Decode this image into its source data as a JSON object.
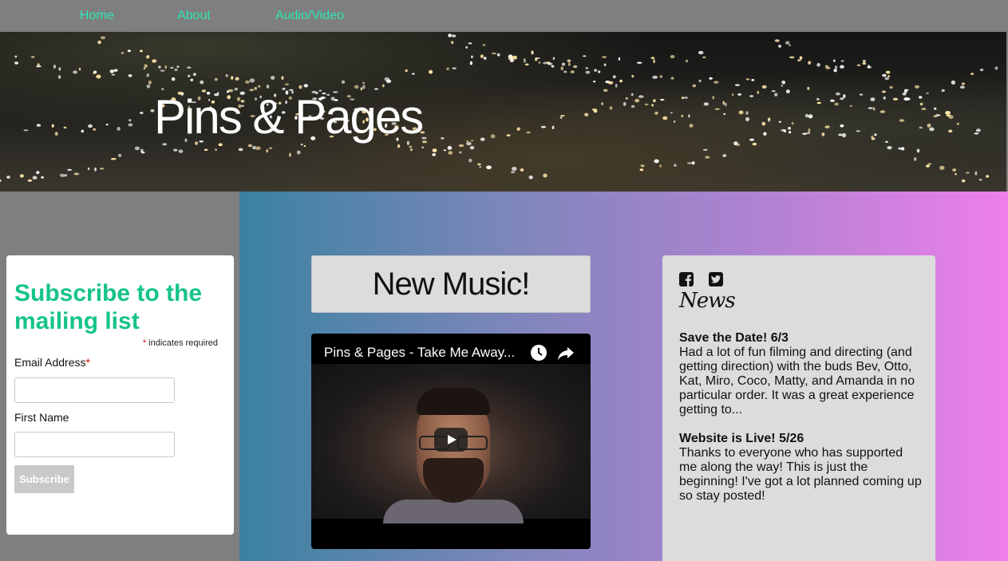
{
  "nav": {
    "items": [
      {
        "label": "Home"
      },
      {
        "label": "About"
      },
      {
        "label": "Audio/Video"
      }
    ]
  },
  "banner": {
    "title": "Pins & Pages"
  },
  "subscribe": {
    "title": "Subscribe to the mailing list",
    "required_star": "*",
    "required_note": " indicates required",
    "email_label": "Email Address",
    "email_star": "*",
    "email_value": "",
    "first_name_label": "First Name",
    "first_name_value": "",
    "button_label": "Subscribe"
  },
  "main": {
    "new_music_label": "New Music!",
    "video": {
      "title": "Pins & Pages - Take Me Away...",
      "icons": [
        "clock-icon",
        "share-icon",
        "play-icon"
      ]
    }
  },
  "news": {
    "social_icons": [
      "facebook-icon",
      "twitter-icon"
    ],
    "heading": "News",
    "items": [
      {
        "title": "Save the Date! 6/3",
        "body": "Had a lot of fun filming and directing (and getting direction) with the buds Bev, Otto, Kat, Miro, Coco, Matty, and Amanda in no particular order. It was a great experience getting to..."
      },
      {
        "title": "Website is Live! 5/26",
        "body": "Thanks to everyone who has supported me along the way! This is just the beginning! I've got a lot planned coming up so stay posted!"
      }
    ]
  },
  "colors": {
    "nav_link": "#2de6b5",
    "subscribe_title": "#15c38b",
    "gradient_start": "#3a82a0",
    "gradient_end": "#ee7fea",
    "page_bg": "#7f7f7f"
  }
}
